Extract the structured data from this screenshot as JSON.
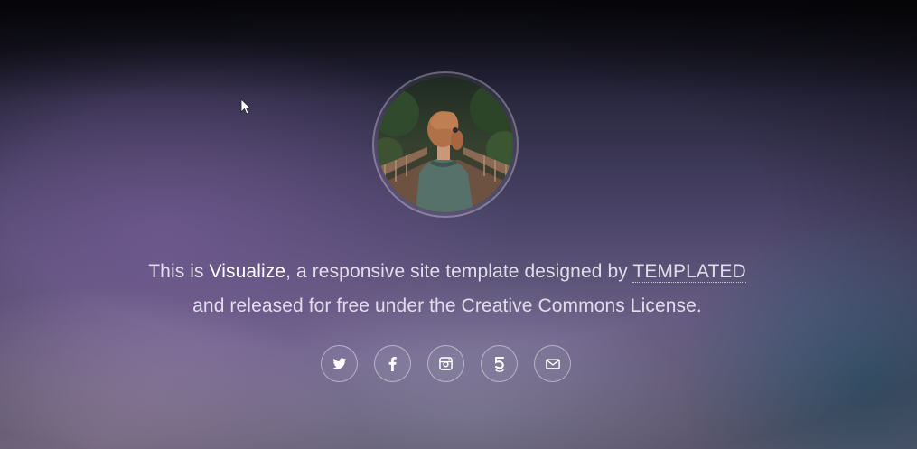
{
  "intro": {
    "line1_prefix": "This is ",
    "site_name": "Visualize",
    "line1_middle": ", a responsive site template designed by ",
    "templated_link": "TEMPLATED",
    "line2": "and released for free under the Creative Commons License."
  },
  "social": [
    {
      "icon": "twitter-icon"
    },
    {
      "icon": "facebook-icon"
    },
    {
      "icon": "instagram-icon"
    },
    {
      "icon": "500px-icon"
    },
    {
      "icon": "envelope-icon"
    }
  ],
  "colors": {
    "text": "#e9e6f2",
    "ring": "rgba(255,255,255,0.45)",
    "background_top": "#0f0f18",
    "background_purple": "#765c96",
    "background_teal": "#286e8c"
  }
}
